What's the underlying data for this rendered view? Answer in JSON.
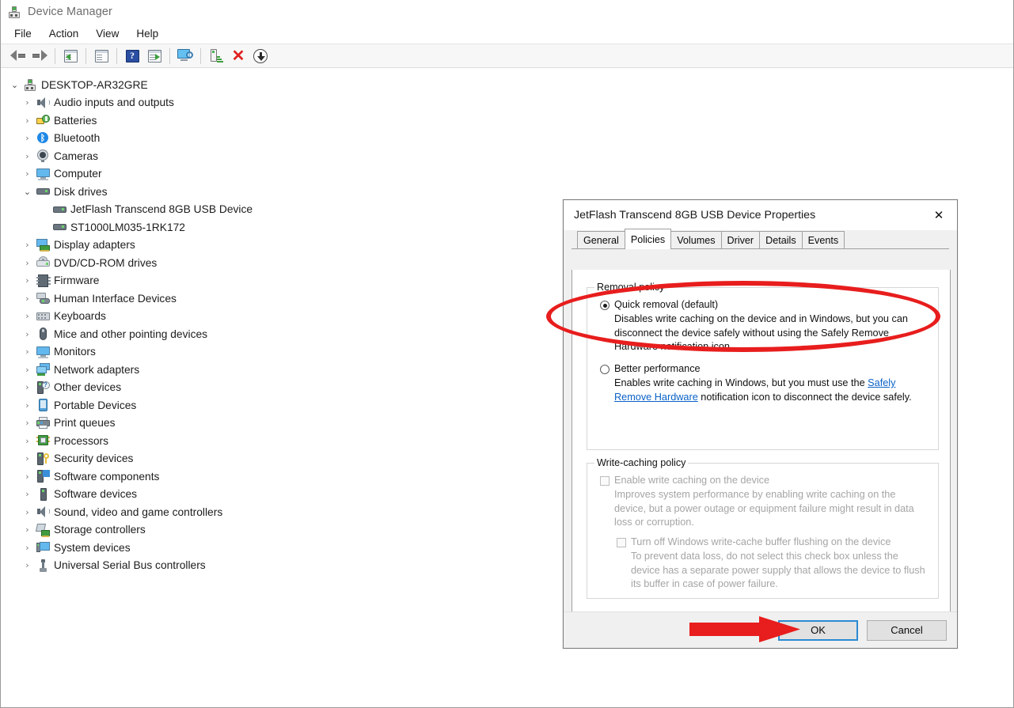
{
  "window": {
    "title": "Device Manager",
    "icon": "device-manager-icon"
  },
  "menubar": {
    "items": [
      {
        "label": "File"
      },
      {
        "label": "Action"
      },
      {
        "label": "View"
      },
      {
        "label": "Help"
      }
    ]
  },
  "toolbar": {
    "buttons": [
      {
        "name": "back-button",
        "icon": "back-arrow-icon"
      },
      {
        "name": "forward-button",
        "icon": "forward-arrow-icon"
      },
      {
        "name": "show-hide-console-tree-button",
        "icon": "console-tree-icon"
      },
      {
        "name": "properties-button",
        "icon": "properties-icon"
      },
      {
        "name": "help-button",
        "icon": "help-question-icon"
      },
      {
        "name": "update-driver-button",
        "icon": "update-driver-icon"
      },
      {
        "name": "scan-hardware-changes-button",
        "icon": "scan-monitor-icon"
      },
      {
        "name": "enable-device-button",
        "icon": "enable-device-icon"
      },
      {
        "name": "uninstall-device-button",
        "icon": "red-x-icon"
      },
      {
        "name": "disable-device-button",
        "icon": "down-circle-icon"
      }
    ]
  },
  "tree": {
    "root": {
      "label": "DESKTOP-AR32GRE",
      "icon": "computer-root-icon",
      "expanded": true,
      "chevron": "⌄"
    },
    "nodes": [
      {
        "label": "Audio inputs and outputs",
        "icon": "speaker-icon",
        "level": 1,
        "expanded": false,
        "chevron": "›"
      },
      {
        "label": "Batteries",
        "icon": "battery-icon",
        "level": 1,
        "expanded": false,
        "chevron": "›"
      },
      {
        "label": "Bluetooth",
        "icon": "bluetooth-icon",
        "level": 1,
        "expanded": false,
        "chevron": "›"
      },
      {
        "label": "Cameras",
        "icon": "camera-icon",
        "level": 1,
        "expanded": false,
        "chevron": "›"
      },
      {
        "label": "Computer",
        "icon": "monitor-icon",
        "level": 1,
        "expanded": false,
        "chevron": "›"
      },
      {
        "label": "Disk drives",
        "icon": "disk-drive-icon",
        "level": 1,
        "expanded": true,
        "chevron": "⌄"
      },
      {
        "label": "JetFlash Transcend 8GB USB Device",
        "icon": "disk-drive-icon",
        "level": 2,
        "expanded": null,
        "chevron": ""
      },
      {
        "label": "ST1000LM035-1RK172",
        "icon": "disk-drive-icon",
        "level": 2,
        "expanded": null,
        "chevron": ""
      },
      {
        "label": "Display adapters",
        "icon": "display-adapter-icon",
        "level": 1,
        "expanded": false,
        "chevron": "›"
      },
      {
        "label": "DVD/CD-ROM drives",
        "icon": "dvd-drive-icon",
        "level": 1,
        "expanded": false,
        "chevron": "›"
      },
      {
        "label": "Firmware",
        "icon": "firmware-chip-icon",
        "level": 1,
        "expanded": false,
        "chevron": "›"
      },
      {
        "label": "Human Interface Devices",
        "icon": "hid-icon",
        "level": 1,
        "expanded": false,
        "chevron": "›"
      },
      {
        "label": "Keyboards",
        "icon": "keyboard-icon",
        "level": 1,
        "expanded": false,
        "chevron": "›"
      },
      {
        "label": "Mice and other pointing devices",
        "icon": "mouse-icon",
        "level": 1,
        "expanded": false,
        "chevron": "›"
      },
      {
        "label": "Monitors",
        "icon": "monitor-icon",
        "level": 1,
        "expanded": false,
        "chevron": "›"
      },
      {
        "label": "Network adapters",
        "icon": "network-adapter-icon",
        "level": 1,
        "expanded": false,
        "chevron": "›"
      },
      {
        "label": "Other devices",
        "icon": "other-device-icon",
        "level": 1,
        "expanded": false,
        "chevron": "›"
      },
      {
        "label": "Portable Devices",
        "icon": "portable-device-icon",
        "level": 1,
        "expanded": false,
        "chevron": "›"
      },
      {
        "label": "Print queues",
        "icon": "printer-icon",
        "level": 1,
        "expanded": false,
        "chevron": "›"
      },
      {
        "label": "Processors",
        "icon": "processor-icon",
        "level": 1,
        "expanded": false,
        "chevron": "›"
      },
      {
        "label": "Security devices",
        "icon": "security-key-icon",
        "level": 1,
        "expanded": false,
        "chevron": "›"
      },
      {
        "label": "Software components",
        "icon": "software-component-icon",
        "level": 1,
        "expanded": false,
        "chevron": "›"
      },
      {
        "label": "Software devices",
        "icon": "software-device-icon",
        "level": 1,
        "expanded": false,
        "chevron": "›"
      },
      {
        "label": "Sound, video and game controllers",
        "icon": "speaker-icon",
        "level": 1,
        "expanded": false,
        "chevron": "›"
      },
      {
        "label": "Storage controllers",
        "icon": "storage-controller-icon",
        "level": 1,
        "expanded": false,
        "chevron": "›"
      },
      {
        "label": "System devices",
        "icon": "system-device-icon",
        "level": 1,
        "expanded": false,
        "chevron": "›"
      },
      {
        "label": "Universal Serial Bus controllers",
        "icon": "usb-icon",
        "level": 1,
        "expanded": false,
        "chevron": "›"
      }
    ]
  },
  "dialog": {
    "title": "JetFlash Transcend 8GB USB Device Properties",
    "close_glyph": "✕",
    "tabs": [
      {
        "label": "General",
        "active": false
      },
      {
        "label": "Policies",
        "active": true
      },
      {
        "label": "Volumes",
        "active": false
      },
      {
        "label": "Driver",
        "active": false
      },
      {
        "label": "Details",
        "active": false
      },
      {
        "label": "Events",
        "active": false
      }
    ],
    "removal_policy": {
      "group_title": "Removal policy",
      "quick_removal": {
        "label": "Quick removal (default)",
        "selected": true,
        "description": "Disables write caching on the device and in Windows, but you can disconnect the device safely without using the Safely Remove Hardware notification icon."
      },
      "better_performance": {
        "label": "Better performance",
        "selected": false,
        "description_pre": "Enables write caching in Windows, but you must use the ",
        "link_text": "Safely Remove Hardware",
        "description_post": " notification icon to disconnect the device safely."
      }
    },
    "write_caching_policy": {
      "group_title": "Write-caching policy",
      "enable_write_caching": {
        "label": "Enable write caching on the device",
        "checked": false,
        "enabled": false,
        "description": "Improves system performance by enabling write caching on the device, but a power outage or equipment failure might result in data loss or corruption."
      },
      "turn_off_buffer_flushing": {
        "label": "Turn off Windows write-cache buffer flushing on the device",
        "checked": false,
        "enabled": false,
        "description": "To prevent data loss, do not select this check box unless the device has a separate power supply that allows the device to flush its buffer in case of power failure."
      }
    },
    "buttons": {
      "ok": "OK",
      "cancel": "Cancel"
    }
  },
  "annotations": {
    "ellipse": {
      "name": "red-ellipse-highlight",
      "color": "#e81d1d",
      "target": "Quick removal (default) option"
    },
    "arrow": {
      "name": "red-arrow-pointer",
      "color": "#e81d1d",
      "target": "OK button",
      "direction": "right"
    }
  }
}
